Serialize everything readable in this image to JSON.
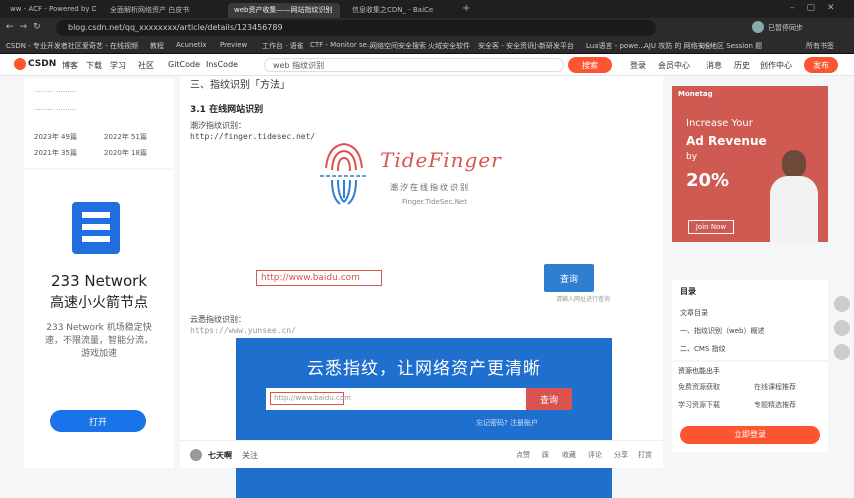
{
  "browser": {
    "tabs": [
      {
        "label": "ww - ACF - Powered by Dis"
      },
      {
        "label": "全面解析网络资产 白皮书"
      },
      {
        "label": "web资产收集——网站指纹识别",
        "active": true
      },
      {
        "label": "信息收集之CDN_ - BaiCe"
      }
    ],
    "url": "blog.csdn.net/qq_xxxxxxxx/article/details/123456789",
    "profile_label": "已暂停同步",
    "bookmarks": [
      "CSDN - 专业开发者社区",
      "爱奇艺 - 在线视频",
      "教程",
      "Acunetix",
      "Preview",
      "工作台 · 语雀",
      "CTF - Monitor se...",
      "网络空间安全搜索",
      "火绒安全软件",
      "安全客 - 安全资讯",
      "小新研发平台",
      "Lua语言 - powe...",
      "AJU 攻防 的 网络安全",
      "Lil 地区 Session 题",
      "所有书签"
    ]
  },
  "csdn": {
    "logo": "CSDN",
    "nav": [
      "博客",
      "下载",
      "学习",
      "社区",
      "GitCode",
      "InsCode",
      "web 指纹识别"
    ],
    "search_button": "搜索",
    "right": [
      "登录",
      "会员中心",
      "消息",
      "历史",
      "创作中心"
    ],
    "publish_button": "发布"
  },
  "left": {
    "stats": [
      "2023年 49篇",
      "2022年 51篇",
      "2021年 35篇",
      "2020年 18篇"
    ],
    "ad": {
      "title": "233 Network",
      "subtitle": "高速小火箭节点",
      "desc": "233 Network 机场稳定快速，不限流量，智能分流，游戏加速",
      "button": "打开"
    }
  },
  "article": {
    "section": "三、指纹识别「方法」",
    "subsection": "3.1 在线网站识别",
    "online_label": "潮汐指纹识别：",
    "online_url": "http://finger.tidesec.net/",
    "logo_brand": "TideFinger",
    "logo_cn": "潮汐在线指纹识别",
    "logo_url": "Finger.TideSec.Net",
    "input_value": "http://www.baidu.com",
    "query_button": "查询",
    "query_hint": "请输入网址进行查询",
    "yunxi_label": "云悉指纹识别：",
    "yunxi_url": "https://www.yunsee.cn/",
    "banner_title": "云悉指纹，让网络资产更清晰",
    "banner_input": "http://www.baidu.com",
    "banner_button": "查询",
    "banner_hint": "忘记密码?   注册账户",
    "author": "七天啊",
    "follow": "关注",
    "actions": [
      "点赞",
      "踩",
      "收藏",
      "评论",
      "分享",
      "打赏"
    ]
  },
  "right": {
    "ad_brand": "Monetag",
    "ad_line1": "Increase Your",
    "ad_line2": "Ad Revenue",
    "ad_line3": "by",
    "ad_line4": "20%",
    "ad_button": "Join Now",
    "toc_title": "目录",
    "toc_items": [
      "文章目录",
      "一、指纹识别（web）概述",
      "二、CMS 指纹"
    ],
    "box_title": "资源也能出手",
    "box_items": [
      "免费资源获取",
      "在线课程推荐",
      "学习资源下载",
      "专题精选推荐"
    ],
    "box_button": "立即登录"
  }
}
